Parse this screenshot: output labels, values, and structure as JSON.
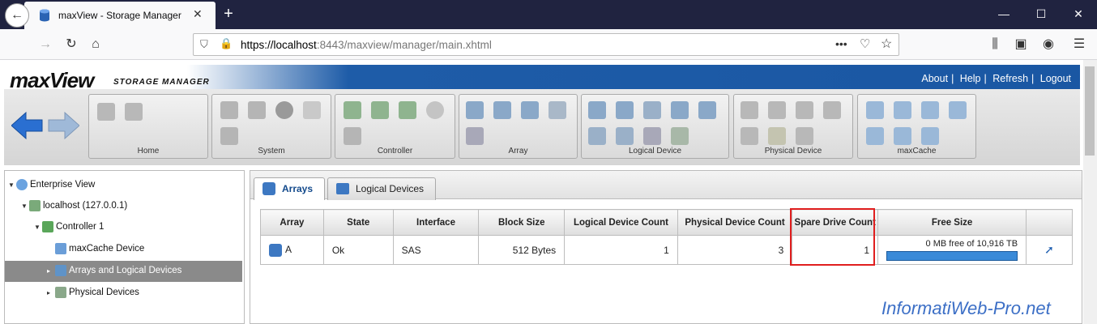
{
  "browser": {
    "tab_title": "maxView - Storage Manager",
    "url_host": "https://localhost",
    "url_rest": ":8443/maxview/manager/main.xhtml"
  },
  "app": {
    "logo": "maxView",
    "logo_sub": "STORAGE MANAGER",
    "links": [
      "About",
      "Help",
      "Refresh",
      "Logout"
    ]
  },
  "toolbar_groups": [
    "Home",
    "System",
    "Controller",
    "Array",
    "Logical Device",
    "Physical Device",
    "maxCache"
  ],
  "tree": {
    "items": [
      {
        "label": "Enterprise View"
      },
      {
        "label": "localhost (127.0.0.1)"
      },
      {
        "label": "Controller 1"
      },
      {
        "label": "maxCache Device"
      },
      {
        "label": "Arrays and Logical Devices"
      },
      {
        "label": "Physical Devices"
      }
    ]
  },
  "tabs": [
    "Arrays",
    "Logical Devices"
  ],
  "table": {
    "headers": [
      "Array",
      "State",
      "Interface",
      "Block Size",
      "Logical Device Count",
      "Physical Device Count",
      "Spare Drive Count",
      "Free Size",
      ""
    ],
    "row": {
      "array": "A",
      "state": "Ok",
      "interface": "SAS",
      "block_size": "512 Bytes",
      "logical_count": "1",
      "physical_count": "3",
      "spare_count": "1",
      "free_size": "0 MB free of 10,916 TB",
      "free_fraction": 1.0
    }
  },
  "watermark": "InformatiWeb-Pro.net",
  "colors": {
    "accent": "#1a57a3",
    "highlight": "#e01e1e",
    "bar": "#3a8ad8"
  }
}
